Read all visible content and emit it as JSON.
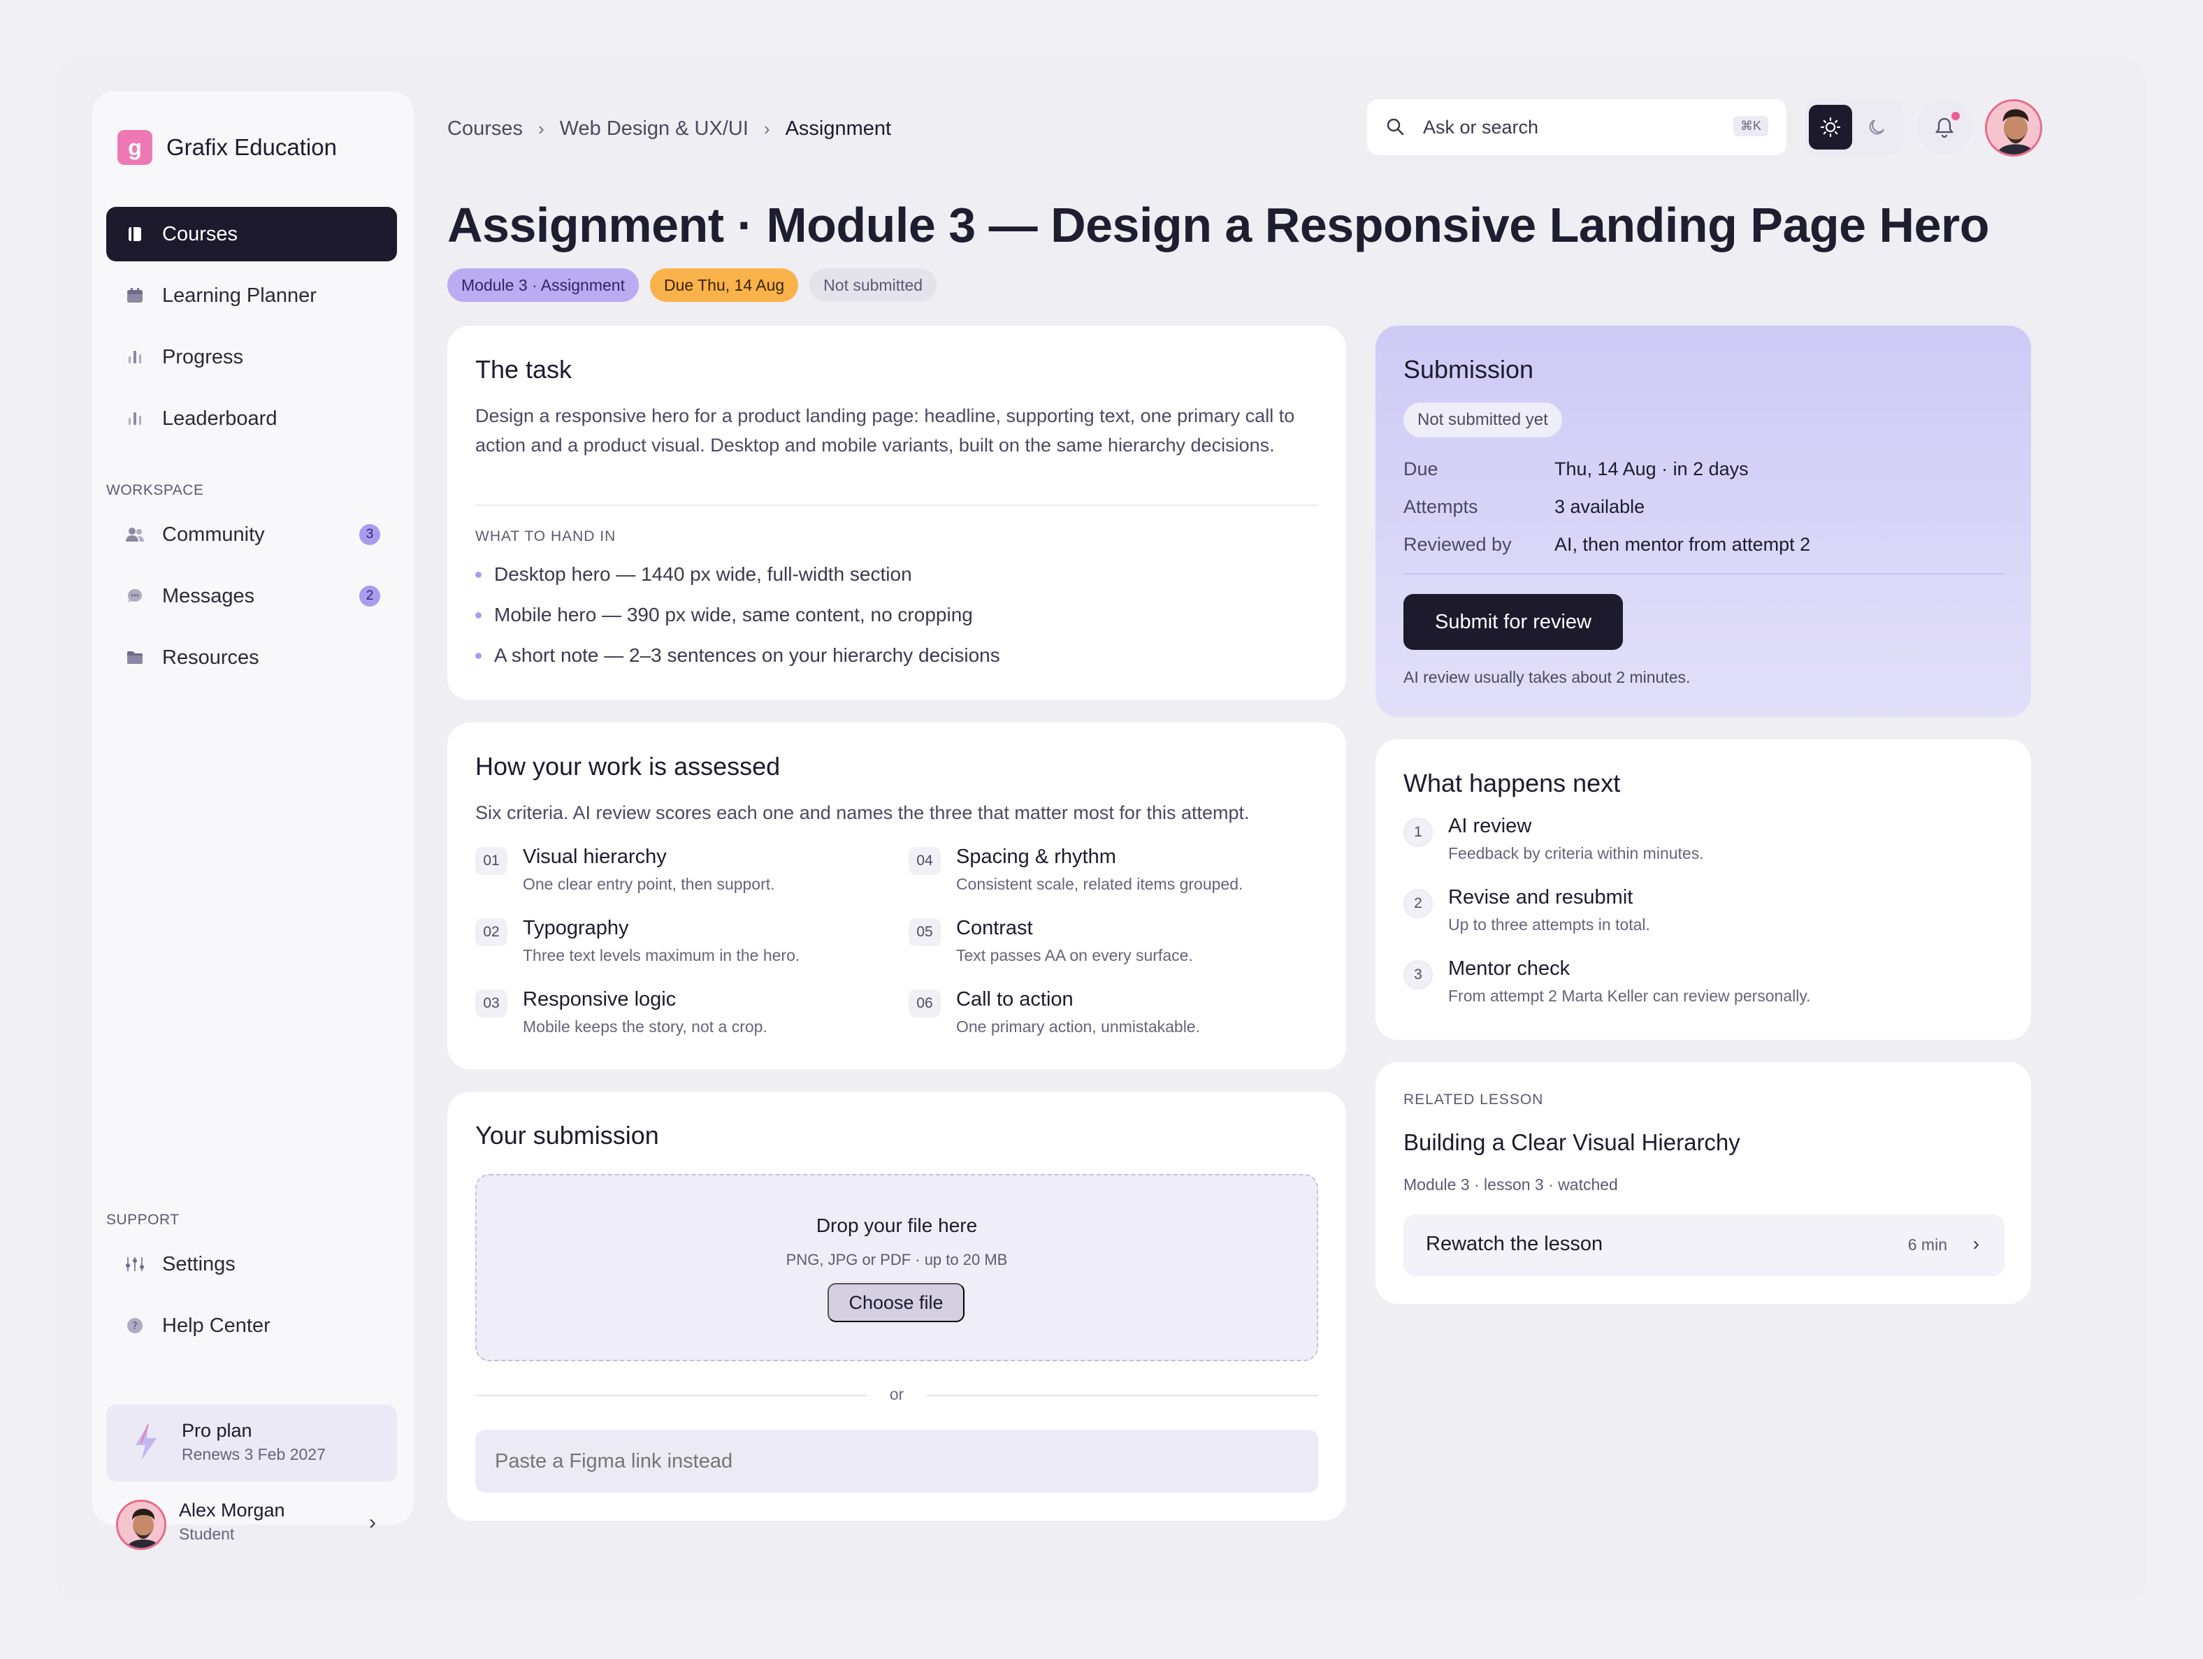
{
  "brand": {
    "name": "Grafix Education",
    "logo_letter": "g",
    "logo_color": "#ee78b4"
  },
  "sidebar": {
    "nav": [
      {
        "label": "Courses",
        "icon": "book-icon",
        "active": true
      },
      {
        "label": "Learning Planner",
        "icon": "calendar-icon"
      },
      {
        "label": "Progress",
        "icon": "bar-chart-icon"
      },
      {
        "label": "Leaderboard",
        "icon": "bar-chart-icon"
      }
    ],
    "workspace_label": "WORKSPACE",
    "workspace": [
      {
        "label": "Community",
        "icon": "users-icon",
        "badge": "3"
      },
      {
        "label": "Messages",
        "icon": "chat-icon",
        "badge": "2"
      },
      {
        "label": "Resources",
        "icon": "folder-icon"
      }
    ],
    "support_label": "SUPPORT",
    "support": [
      {
        "label": "Settings",
        "icon": "sliders-icon"
      },
      {
        "label": "Help Center",
        "icon": "help-icon"
      }
    ],
    "plan": {
      "title": "Pro plan",
      "subtitle": "Renews 3 Feb 2027",
      "icon": "lightning-icon"
    },
    "user": {
      "name": "Alex Morgan",
      "role": "Student"
    }
  },
  "breadcrumb": {
    "items": [
      "Courses",
      "Web Design & UX/UI"
    ],
    "current": "Assignment"
  },
  "search": {
    "placeholder": "Ask or search",
    "shortcut": "⌘K"
  },
  "page": {
    "title": "Assignment · Module 3 — Design a Responsive Landing Page Hero",
    "chips": {
      "module": "Module 3 · Assignment",
      "due": "Due Thu, 14 Aug",
      "status": "Not submitted"
    }
  },
  "task": {
    "heading": "The task",
    "description": "Design a responsive hero for a product landing page: headline, supporting text, one primary call to action and a product visual. Desktop and mobile variants, built on the same hierarchy decisions.",
    "hand_in_label": "WHAT TO HAND IN",
    "hand_in": [
      "Desktop hero — 1440 px wide, full-width section",
      "Mobile hero — 390 px wide, same content, no cropping",
      "A short note — 2–3 sentences on your hierarchy decisions"
    ]
  },
  "assessment": {
    "heading": "How your work is assessed",
    "intro": "Six criteria. AI review scores each one and names the three that matter most for this attempt.",
    "criteria": [
      {
        "num": "01",
        "title": "Visual hierarchy",
        "desc": "One clear entry point, then support."
      },
      {
        "num": "02",
        "title": "Typography",
        "desc": "Three text levels maximum in the hero."
      },
      {
        "num": "03",
        "title": "Responsive logic",
        "desc": "Mobile keeps the story, not a crop."
      },
      {
        "num": "04",
        "title": "Spacing & rhythm",
        "desc": "Consistent scale, related items grouped."
      },
      {
        "num": "05",
        "title": "Contrast",
        "desc": "Text passes AA on every surface."
      },
      {
        "num": "06",
        "title": "Call to action",
        "desc": "One primary action, unmistakable."
      }
    ]
  },
  "your_submission": {
    "heading": "Your submission",
    "drop_title": "Drop your file here",
    "drop_sub": "PNG, JPG or PDF · up to 20 MB",
    "choose_label": "Choose file",
    "or_label": "or",
    "link_placeholder": "Paste a Figma link instead"
  },
  "submission": {
    "heading": "Submission",
    "status": "Not submitted yet",
    "rows": [
      {
        "label": "Due",
        "value": "Thu, 14 Aug · in 2 days"
      },
      {
        "label": "Attempts",
        "value": "3 available"
      },
      {
        "label": "Reviewed by",
        "value": "AI, then mentor from attempt 2"
      }
    ],
    "button": "Submit for review",
    "note": "AI review usually takes about 2 minutes."
  },
  "next": {
    "heading": "What happens next",
    "steps": [
      {
        "num": "1",
        "title": "AI review",
        "desc": "Feedback by criteria within minutes."
      },
      {
        "num": "2",
        "title": "Revise and resubmit",
        "desc": "Up to three attempts in total."
      },
      {
        "num": "3",
        "title": "Mentor check",
        "desc": "From attempt 2 Marta Keller can review personally."
      }
    ]
  },
  "related": {
    "label": "RELATED LESSON",
    "title": "Building a Clear Visual Hierarchy",
    "meta": "Module 3 · lesson 3 · watched",
    "action": "Rewatch the lesson",
    "duration": "6 min"
  }
}
